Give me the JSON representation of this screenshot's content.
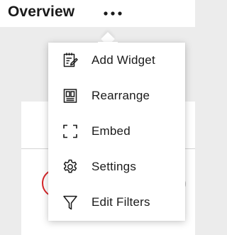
{
  "header": {
    "title": "Overview",
    "more_icon": "more-horizontal-icon"
  },
  "menu": {
    "items": [
      {
        "label": "Add Widget",
        "icon": "add-widget-icon"
      },
      {
        "label": "Rearrange",
        "icon": "rearrange-icon"
      },
      {
        "label": "Embed",
        "icon": "embed-icon"
      },
      {
        "label": "Settings",
        "icon": "settings-gear-icon"
      },
      {
        "label": "Edit Filters",
        "icon": "filter-icon"
      }
    ]
  },
  "colors": {
    "background": "#ececec",
    "surface": "#ffffff",
    "text": "#1a1a1a",
    "accent_red": "#d7262a"
  }
}
